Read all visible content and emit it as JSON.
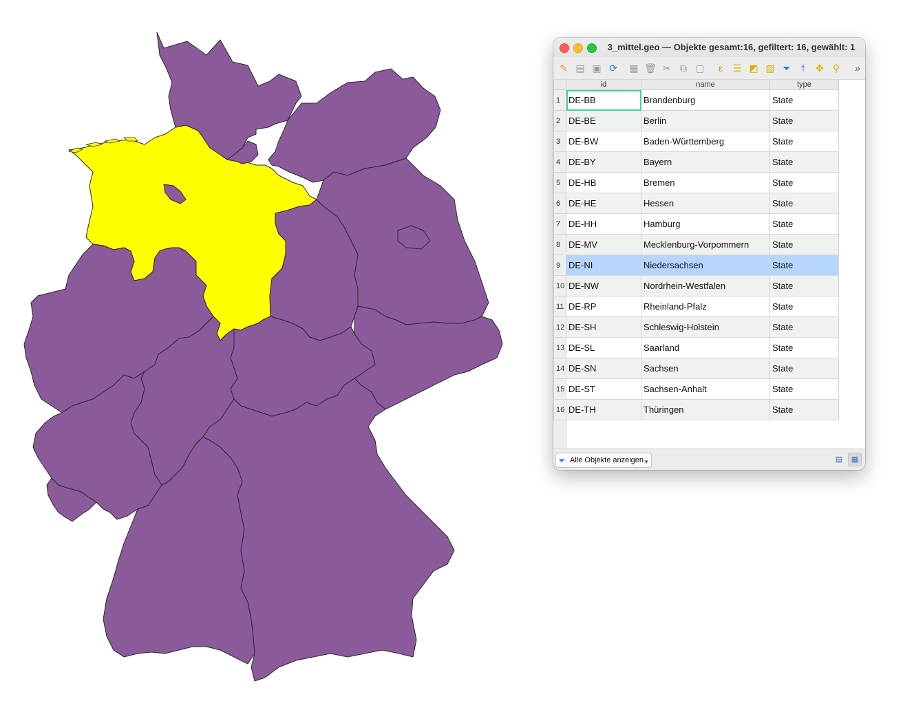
{
  "map": {
    "fill_color": "#8a5a9a",
    "highlight_color": "#ffff00",
    "highlighted_feature": "DE-NI"
  },
  "window": {
    "title": "3_mittel.geo — Objekte gesamt:16, gefiltert: 16, gewählt: 1",
    "toolbar_icons": [
      "edit-pencil-icon",
      "multi-edit-icon",
      "save-edits-icon",
      "reload-icon",
      "add-feature-icon",
      "delete-feature-icon",
      "cut-icon",
      "copy-icon",
      "paste-icon",
      "expression-select-icon",
      "select-all-icon",
      "invert-selection-icon",
      "deselect-icon",
      "filter-icon",
      "move-selection-top-icon",
      "pan-to-selection-icon",
      "zoom-to-selection-icon",
      "more-icon"
    ],
    "columns": [
      "id",
      "name",
      "type"
    ],
    "rows": [
      {
        "n": "1",
        "id": "DE-BB",
        "name": "Brandenburg",
        "type": "State"
      },
      {
        "n": "2",
        "id": "DE-BE",
        "name": "Berlin",
        "type": "State"
      },
      {
        "n": "3",
        "id": "DE-BW",
        "name": "Baden-Württemberg",
        "type": "State"
      },
      {
        "n": "4",
        "id": "DE-BY",
        "name": "Bayern",
        "type": "State"
      },
      {
        "n": "5",
        "id": "DE-HB",
        "name": "Bremen",
        "type": "State"
      },
      {
        "n": "6",
        "id": "DE-HE",
        "name": "Hessen",
        "type": "State"
      },
      {
        "n": "7",
        "id": "DE-HH",
        "name": "Hamburg",
        "type": "State"
      },
      {
        "n": "8",
        "id": "DE-MV",
        "name": "Mecklenburg-Vorpommern",
        "type": "State"
      },
      {
        "n": "9",
        "id": "DE-NI",
        "name": "Niedersachsen",
        "type": "State"
      },
      {
        "n": "10",
        "id": "DE-NW",
        "name": "Nordrhein-Westfalen",
        "type": "State"
      },
      {
        "n": "11",
        "id": "DE-RP",
        "name": "Rheinland-Pfalz",
        "type": "State"
      },
      {
        "n": "12",
        "id": "DE-SH",
        "name": "Schleswig-Holstein",
        "type": "State"
      },
      {
        "n": "13",
        "id": "DE-SL",
        "name": "Saarland",
        "type": "State"
      },
      {
        "n": "14",
        "id": "DE-SN",
        "name": "Sachsen",
        "type": "State"
      },
      {
        "n": "15",
        "id": "DE-ST",
        "name": "Sachsen-Anhalt",
        "type": "State"
      },
      {
        "n": "16",
        "id": "DE-TH",
        "name": "Thüringen",
        "type": "State"
      }
    ],
    "selected_row": "9",
    "filter_button_label": "Alle Objekte anzeigen"
  }
}
